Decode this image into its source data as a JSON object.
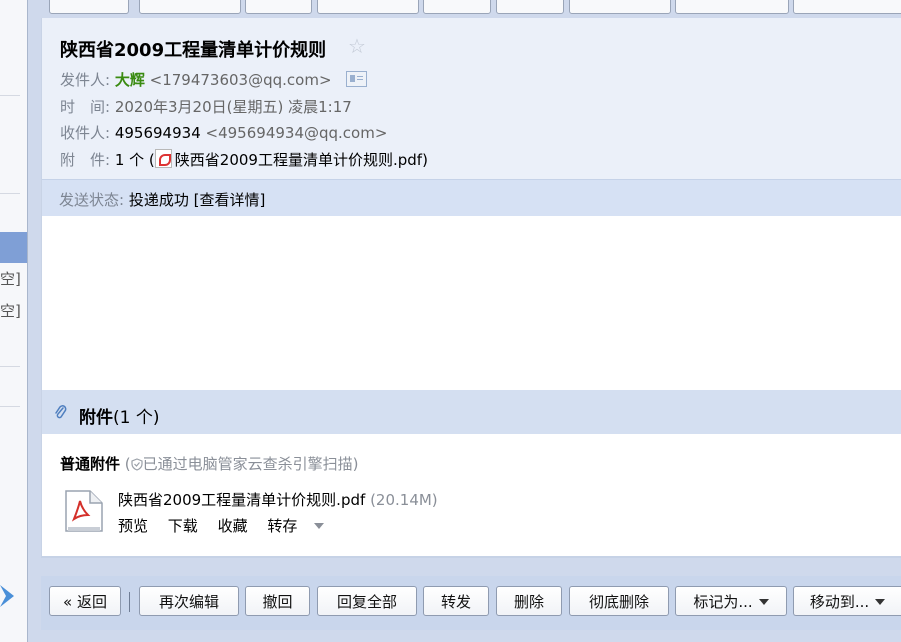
{
  "sidebar": {
    "cut_labels": [
      "空]",
      "空]"
    ]
  },
  "mail": {
    "subject": "陕西省2009工程量清单计价规则",
    "sender_label": "发件人:",
    "sender_name": "大辉",
    "sender_email": "<179473603@qq.com>",
    "time_label": "时　间:",
    "time_value": "2020年3月20日(星期五) 凌晨1:17",
    "recipient_label": "收件人:",
    "recipient_name": "495694934",
    "recipient_email": "<495694934@qq.com>",
    "attachment_label": "附　件:",
    "attachment_count": "1 个 (",
    "attachment_name": "陕西省2009工程量清单计价规则.pdf",
    "attachment_close": ")",
    "status_label": "发送状态:",
    "status_value": "投递成功",
    "status_details": "[查看详情]"
  },
  "attachments": {
    "title": "附件",
    "count": "(1 个)",
    "kind": "普通附件",
    "scan_open": "(",
    "scan_note": "已通过电脑管家云查杀引擎扫描",
    "scan_close": ")",
    "file_name": "陕西省2009工程量清单计价规则.pdf",
    "file_size": "(20.14M)",
    "actions": {
      "preview": "预览",
      "download": "下载",
      "favorite": "收藏",
      "save_to": "转存"
    }
  },
  "toolbar": {
    "back": "« 返回",
    "edit_again": "再次编辑",
    "recall": "撤回",
    "reply_all": "回复全部",
    "forward": "转发",
    "delete": "删除",
    "delete_permanently": "彻底删除",
    "mark_as": "标记为...",
    "move_to": "移动到..."
  },
  "colors": {
    "sender_name": "#3a8b11",
    "page_background": "#cfd9ec",
    "header_background": "#ebf0f9",
    "status_background": "#d6e1f4",
    "attachment_header": "#d4dff1"
  },
  "icons": {
    "subject_star": "star-icon",
    "contact": "contact-card-icon",
    "attachment_clip": "paperclip-icon",
    "scan_shield": "shield-icon",
    "file": "pdf-file-icon",
    "dropdown": "chevron-down-icon"
  }
}
